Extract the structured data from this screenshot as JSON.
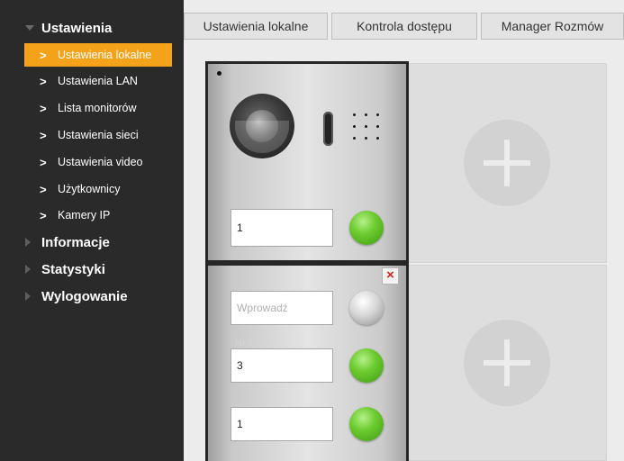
{
  "sidebar": {
    "sections": [
      {
        "label": "Ustawienia",
        "expanded": true
      },
      {
        "label": "Informacje",
        "expanded": false
      },
      {
        "label": "Statystyki",
        "expanded": false
      },
      {
        "label": "Wylogowanie",
        "expanded": false
      }
    ],
    "items": [
      {
        "label": "Ustawienia lokalne",
        "active": true
      },
      {
        "label": "Ustawienia LAN"
      },
      {
        "label": "Lista monitorów"
      },
      {
        "label": "Ustawienia sieci"
      },
      {
        "label": "Ustawienia video"
      },
      {
        "label": "Użytkownicy"
      },
      {
        "label": "Kamery IP"
      }
    ]
  },
  "tabs": [
    {
      "label": "Ustawienia lokalne",
      "active": true
    },
    {
      "label": "Kontrola dostępu"
    },
    {
      "label": "Manager Rozmów"
    }
  ],
  "modules": {
    "camera": {
      "field_value": "1"
    },
    "buttons": {
      "rows": [
        {
          "placeholder": "Wprowadź",
          "value": "",
          "button_color": "grey"
        },
        {
          "value": "3",
          "button_color": "green"
        },
        {
          "value": "1",
          "button_color": "green"
        }
      ],
      "overlay_text": "Nr lokalu"
    }
  },
  "colors": {
    "sidebar_bg": "#2a2a2a",
    "active_item": "#f5a21b",
    "green_button": "#6dcc30",
    "close_icon": "#d32222"
  }
}
